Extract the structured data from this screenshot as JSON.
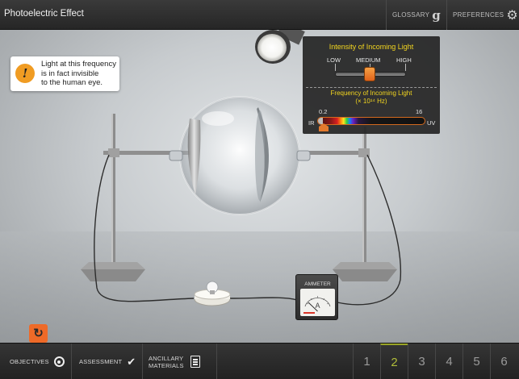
{
  "header": {
    "title": "Photoelectric Effect",
    "glossary_label": "GLOSSARY",
    "preferences_label": "PREFERENCES",
    "glossary_icon": "g-logo-icon",
    "preferences_icon": "gear-icon"
  },
  "tooltip": {
    "icon": "warning-icon",
    "lines": [
      "Light at this frequency",
      "is in fact invisible",
      "to the human eye."
    ],
    "color": "#f09c23"
  },
  "controls": {
    "intensity": {
      "title": "Intensity of Incoming Light",
      "levels": [
        "LOW",
        "MEDIUM",
        "HIGH"
      ],
      "selected": "MEDIUM"
    },
    "frequency": {
      "title": "Frequency of Incoming Light",
      "unit": "(× 10¹⁴ Hz)",
      "min_label": "0.2",
      "max_label": "16",
      "left_label": "IR",
      "right_label": "UV",
      "value": 0.2
    },
    "title_color": "#f2d51f",
    "accent_color": "#e3701f"
  },
  "ammeter": {
    "label": "AMMETER",
    "unit": "A"
  },
  "reset": {
    "icon": "reset-icon",
    "color": "#ee6a28"
  },
  "bottom_nav": {
    "objectives_label": "OBJECTIVES",
    "assessment_label": "ASSESSMENT",
    "ancillary_label_1": "ANCILLARY",
    "ancillary_label_2": "MATERIALS",
    "pages": [
      "1",
      "2",
      "3",
      "4",
      "5",
      "6"
    ],
    "active_page": "2",
    "active_color": "#b0bc3a"
  }
}
